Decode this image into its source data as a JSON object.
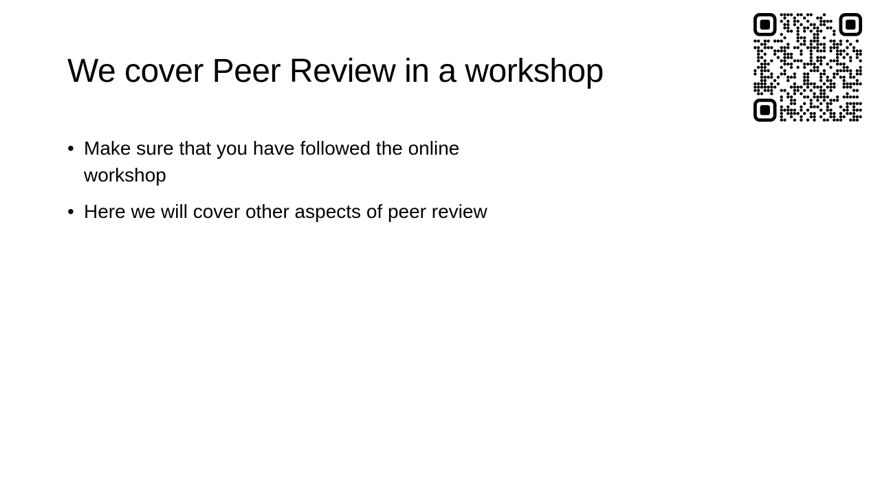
{
  "slide": {
    "title": "We cover Peer Review in a workshop",
    "bullets": [
      "Make sure that you have followed the online workshop",
      "Here we will cover other aspects of peer review"
    ],
    "bullet_glyph": "•"
  },
  "qr_code": {
    "icon": "qr-code-icon",
    "color": "#000000"
  }
}
